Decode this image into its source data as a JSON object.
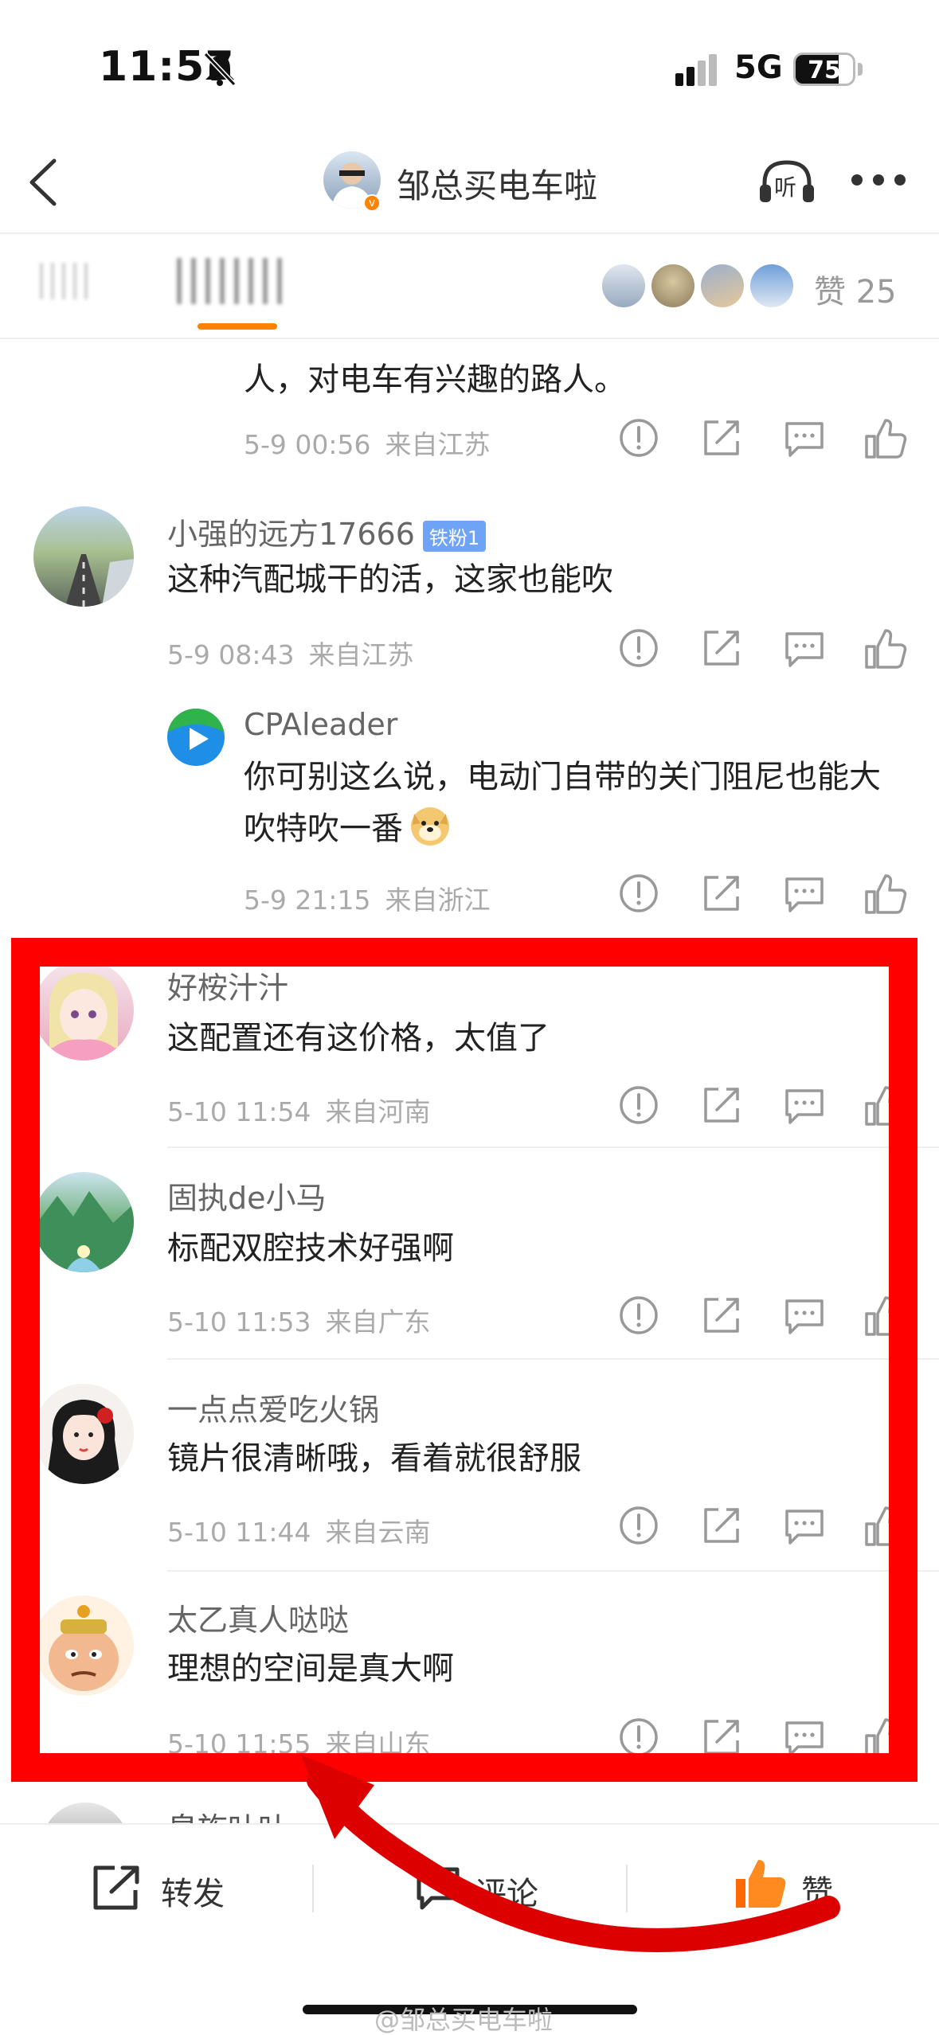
{
  "status_bar": {
    "time": "11:57",
    "network": "5G",
    "battery": "75",
    "battery_level": 0.75
  },
  "header": {
    "title": "邹总买电车啦",
    "listen_label": "听"
  },
  "tabs": {
    "likes_label": "赞 25"
  },
  "comments": [
    {
      "text": "人，对电车有兴趣的路人。",
      "date": "5-9 00:56",
      "location": "来自江苏"
    },
    {
      "user": "小强的远方17666",
      "badge": "铁粉1",
      "text": "这种汽配城干的活，这家也能吹",
      "date": "5-9 08:43",
      "location": "来自江苏"
    },
    {
      "user": "CPAleader",
      "text": "你可别这么说，电动门自带的关门阻尼也能大吹特吹一番",
      "date": "5-9 21:15",
      "location": "来自浙江"
    },
    {
      "user": "好桉汁汁",
      "text": "这配置还有这价格，太值了",
      "date": "5-10 11:54",
      "location": "来自河南"
    },
    {
      "user": "固执de小马",
      "text": "标配双腔技术好强啊",
      "date": "5-10 11:53",
      "location": "来自广东"
    },
    {
      "user": "一点点爱吃火锅",
      "text": "镜片很清晰哦，看着就很舒服",
      "date": "5-10 11:44",
      "location": "来自云南"
    },
    {
      "user": "太乙真人哒哒",
      "text": "理想的空间是真大啊",
      "date": "5-10 11:55",
      "location": "来自山东"
    },
    {
      "user": "皇族叶叶"
    }
  ],
  "bottom_bar": {
    "repost": "转发",
    "comment": "评论",
    "like": "赞"
  },
  "watermark": "@邹总买电车啦",
  "colors": {
    "accent": "#ff8200",
    "annotation": "#ff0000"
  }
}
